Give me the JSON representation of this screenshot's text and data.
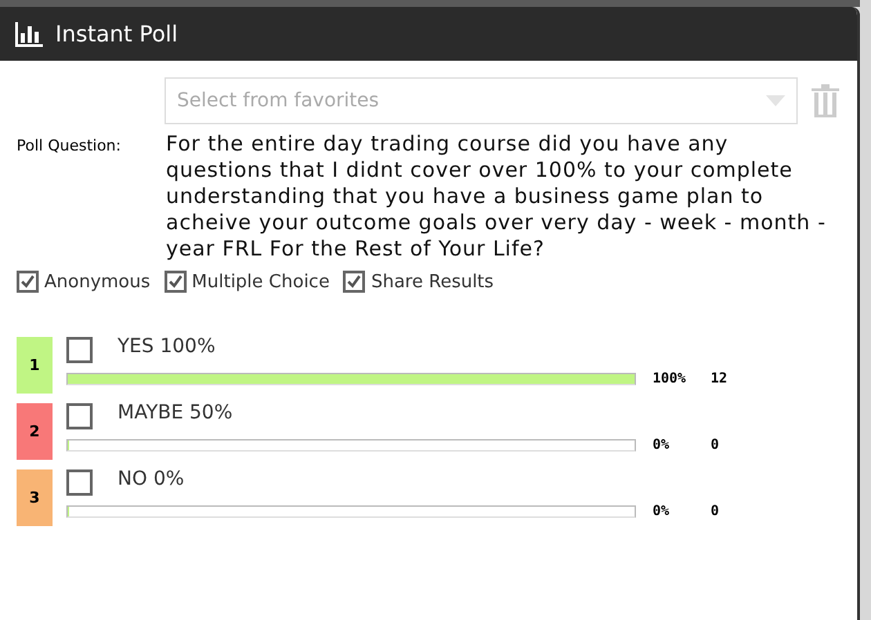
{
  "window": {
    "title": "Instant Poll"
  },
  "favorites": {
    "placeholder": "Select from favorites"
  },
  "question": {
    "label": "Poll Question:",
    "text": "For the entire day trading course did you have any questions that I didnt cover over 100% to your complete understanding that you have a business game plan to acheive your outcome goals over very day - week - month - year FRL For the Rest of Your Life?"
  },
  "options": [
    {
      "label": "Anonymous",
      "checked": true
    },
    {
      "label": "Multiple Choice",
      "checked": true
    },
    {
      "label": "Share Results",
      "checked": true
    }
  ],
  "answers": [
    {
      "number": "1",
      "color": "#c0f584",
      "text": "YES 100%",
      "checked": false,
      "level": 1,
      "percent": "100%",
      "count": "12"
    },
    {
      "number": "2",
      "color": "#f87878",
      "text": "MAYBE 50%",
      "checked": false,
      "level": 0,
      "percent": "0%",
      "count": "0"
    },
    {
      "number": "3",
      "color": "#f8b474",
      "text": "NO 0%",
      "checked": false,
      "level": 0,
      "percent": "0%",
      "count": "0"
    }
  ]
}
